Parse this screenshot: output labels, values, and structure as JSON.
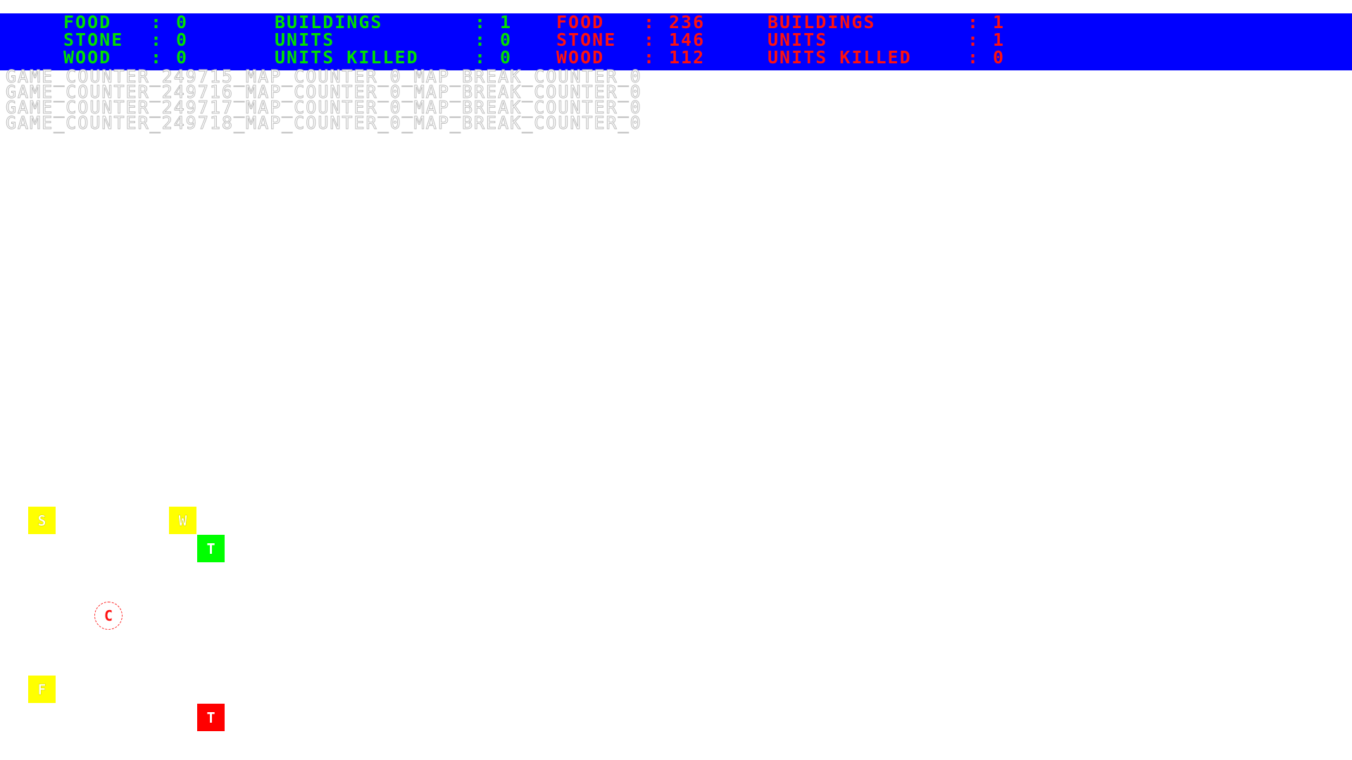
{
  "player1": {
    "color": "#00e000",
    "food_label": "FOOD",
    "food": "0",
    "stone_label": "STONE",
    "stone": "0",
    "wood_label": "WOOD",
    "wood": "0",
    "buildings_label": "BUILDINGS",
    "buildings": "1",
    "units_label": "UNITS",
    "units": "0",
    "killed_label": "UNITS KILLED",
    "killed": "0"
  },
  "player2": {
    "color": "#ff1010",
    "food_label": "FOOD",
    "food": "236",
    "stone_label": "STONE",
    "stone": "146",
    "wood_label": "WOOD",
    "wood": "112",
    "buildings_label": "BUILDINGS",
    "buildings": "1",
    "units_label": "UNITS",
    "units": "1",
    "killed_label": "UNITS KILLED",
    "killed": "0"
  },
  "separator": ":",
  "debug_lines": [
    "GAME_COUNTER_249715_MAP_COUNTER_0_MAP_BREAK_COUNTER_0",
    "GAME_COUNTER_249716_MAP_COUNTER_0_MAP_BREAK_COUNTER_0",
    "GAME_COUNTER_249717_MAP_COUNTER_0_MAP_BREAK_COUNTER_0",
    "GAME_COUNTER_249718_MAP_COUNTER_0_MAP_BREAK_COUNTER_0"
  ],
  "map": {
    "stone_tile": "S",
    "wood_tile": "W",
    "green_town": "T",
    "red_unit": "C",
    "food_tile": "F",
    "red_town": "T"
  },
  "colors": {
    "hud_background": "#0000ff",
    "resource_tile": "#ffff00",
    "player1_building": "#00ff00",
    "player2_building": "#ff0000"
  }
}
